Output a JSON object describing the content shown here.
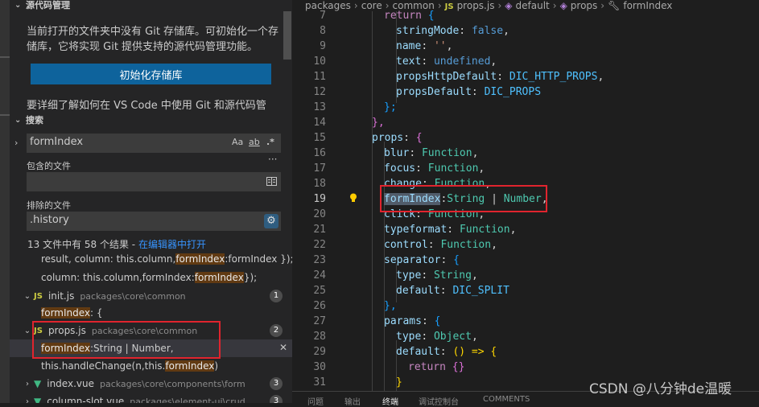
{
  "scm": {
    "title": "源代码管理",
    "message": "当前打开的文件夹中没有 Git 存储库。可初始化一个存储库，它将实现 Git 提供支持的源代码管理功能。",
    "init_button": "初始化存储库",
    "more_text": "要详细了解如何在 VS Code 中使用 Git 和源代码管"
  },
  "search": {
    "title": "搜索",
    "query": "formIndex",
    "opt_case": "Aa",
    "opt_word": "ab",
    "opt_regex": ".*",
    "more": "···",
    "include_label": "包含的文件",
    "include_value": "",
    "exclude_label": "排除的文件",
    "exclude_value": ".history",
    "results_summary": "13 文件中有 58 个结果 - ",
    "open_in_editor": "在编辑器中打开"
  },
  "results": {
    "r0_pre": "result, column: this.column,",
    "r0_hl": "formIndex",
    "r0_post": ":formIndex });",
    "r1_pre": "column: this.column,formIndex:",
    "r1_hl": "formIndex",
    "r1_post": " });",
    "f1_name": "init.js",
    "f1_path": "packages\\core\\common",
    "f1_count": "1",
    "r2_hl": "formIndex",
    "r2_post": ": {",
    "f2_name": "props.js",
    "f2_path": "packages\\core\\common",
    "f2_count": "2",
    "r3_hl": "formIndex",
    "r3_post": ":String | Number,",
    "r3_close": "✕",
    "r4_pre": "this.handleChange(n,this.",
    "r4_hl": "formIndex",
    "r4_post": ")",
    "f3_name": "index.vue",
    "f3_path": "packages\\core\\components\\form",
    "f3_count": "3",
    "f4_name": "column-slot.vue",
    "f4_path": "packages\\element-ui\\crud",
    "f4_count": "3",
    "js_tag": "JS"
  },
  "breadcrumb": {
    "b1": "packages",
    "b2": "core",
    "b3": "common",
    "b4": "props.js",
    "b5": "default",
    "b6": "props",
    "b7": "formIndex",
    "sep": "›"
  },
  "code": {
    "line_numbers": [
      "7",
      "8",
      "9",
      "10",
      "11",
      "12",
      "13",
      "14",
      "15",
      "16",
      "17",
      "18",
      "19",
      "20",
      "21",
      "22",
      "23",
      "24",
      "25",
      "26",
      "27",
      "28",
      "29",
      "30",
      "31"
    ],
    "l7_kw": "return",
    "l7_b": " {",
    "l8_p": "stringMode",
    "l8_v": "false",
    "l9_p": "name",
    "l9_v": "''",
    "l10_p": "text",
    "l10_v": "undefined",
    "l11_p": "propsHttpDefault",
    "l11_v": "DIC_HTTP_PROPS",
    "l12_p": "propsDefault",
    "l12_v": "DIC_PROPS",
    "l13": "};",
    "l14": "},",
    "l15_p": "props",
    "l15_b": "{",
    "l16_p": "blur",
    "l16_v": "Function",
    "l17_p": "focus",
    "l17_v": "Function",
    "l18_p": "change",
    "l18_v": "Function",
    "l19_p": "formIndex",
    "l19_t1": "String",
    "l19_t2": "Number",
    "l20_p": "click",
    "l20_v": "Function",
    "l21_p": "typeformat",
    "l21_v": "Function",
    "l22_p": "control",
    "l22_v": "Function",
    "l23_p": "separator",
    "l24_p": "type",
    "l24_v": "String",
    "l25_p": "default",
    "l25_v": "DIC_SPLIT",
    "l26": "},",
    "l27_p": "params",
    "l28_p": "type",
    "l28_v": "Object",
    "l29_p": "default",
    "l29_v": "() => {",
    "l30_kw": "return",
    "l30_b": " {}",
    "l31": "}"
  },
  "panel": {
    "t1": "问题",
    "t2": "输出",
    "t3": "终端",
    "t4": "调试控制台",
    "t5": "COMMENTS"
  },
  "watermark": "CSDN @八分钟de温暖"
}
